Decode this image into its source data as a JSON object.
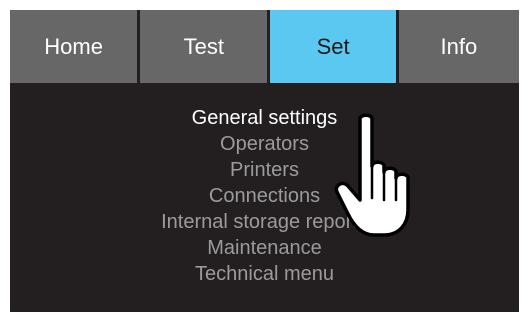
{
  "tabs": [
    {
      "label": "Home",
      "active": false
    },
    {
      "label": "Test",
      "active": false
    },
    {
      "label": "Set",
      "active": true
    },
    {
      "label": "Info",
      "active": false
    }
  ],
  "menu": {
    "items": [
      {
        "label": "General settings",
        "selected": true
      },
      {
        "label": "Operators",
        "selected": false
      },
      {
        "label": "Printers",
        "selected": false
      },
      {
        "label": "Connections",
        "selected": false
      },
      {
        "label": "Internal storage reports",
        "selected": false
      },
      {
        "label": "Maintenance",
        "selected": false
      },
      {
        "label": "Technical menu",
        "selected": false
      }
    ]
  },
  "pointer": {
    "icon": "hand-pointer-icon"
  },
  "colors": {
    "screen_bg": "#231f20",
    "tab_bg": "#676767",
    "tab_active_bg": "#5ac8f0",
    "menu_text": "#9b9b9b",
    "menu_text_selected": "#ffffff"
  }
}
